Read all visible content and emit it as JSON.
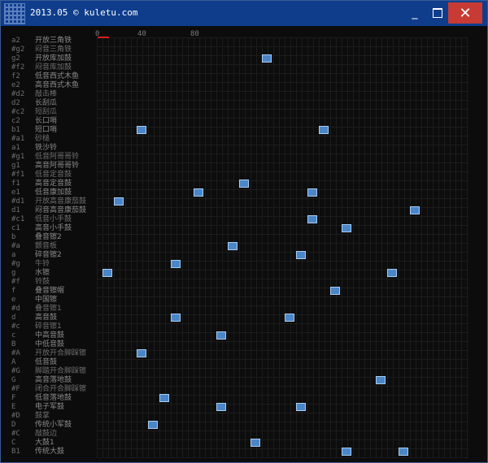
{
  "window": {
    "title": "2013.05 © kuletu.com",
    "icon": "grid-app-icon",
    "minimize": "_",
    "close": "✕"
  },
  "ruler": {
    "labels": [
      "0",
      "40",
      "80"
    ]
  },
  "rows": [
    {
      "note": "a2",
      "name": "开放三角铁"
    },
    {
      "note": "#g2",
      "name": "闷音三角铁"
    },
    {
      "note": "g2",
      "name": "开放库加鼓"
    },
    {
      "note": "#f2",
      "name": "闷音库加鼓"
    },
    {
      "note": "f2",
      "name": "低音西式木鱼"
    },
    {
      "note": "e2",
      "name": "高音西式木鱼"
    },
    {
      "note": "#d2",
      "name": "敲击棒"
    },
    {
      "note": "d2",
      "name": "长刮瓜"
    },
    {
      "note": "#c2",
      "name": "短刮瓜"
    },
    {
      "note": "c2",
      "name": "长口哨"
    },
    {
      "note": "b1",
      "name": "短口哨"
    },
    {
      "note": "#a1",
      "name": "砂槌"
    },
    {
      "note": "a1",
      "name": "铁沙铃"
    },
    {
      "note": "#g1",
      "name": "低音阿哥哥铃"
    },
    {
      "note": "g1",
      "name": "高音阿哥哥铃"
    },
    {
      "note": "#f1",
      "name": "低音定音鼓"
    },
    {
      "note": "f1",
      "name": "高音定音鼓"
    },
    {
      "note": "e1",
      "name": "低音康加鼓"
    },
    {
      "note": "#d1",
      "name": "开放高音康茄鼓"
    },
    {
      "note": "d1",
      "name": "闷音高音康茄鼓"
    },
    {
      "note": "#c1",
      "name": "低音小手鼓"
    },
    {
      "note": "c1",
      "name": "高音小手鼓"
    },
    {
      "note": "b",
      "name": "叠音镲2"
    },
    {
      "note": "#a",
      "name": "颤音板"
    },
    {
      "note": "a",
      "name": "碎音镲2"
    },
    {
      "note": "#g",
      "name": "牛铃"
    },
    {
      "note": "g",
      "name": "水镲"
    },
    {
      "note": "#f",
      "name": "铃鼓"
    },
    {
      "note": "f",
      "name": "叠音镲帽"
    },
    {
      "note": "e",
      "name": "中国镲"
    },
    {
      "note": "#d",
      "name": "叠音镲1"
    },
    {
      "note": "d",
      "name": "高音鼓"
    },
    {
      "note": "#c",
      "name": "碎音镲1"
    },
    {
      "note": "c",
      "name": "中高音鼓"
    },
    {
      "note": "B",
      "name": "中低音鼓"
    },
    {
      "note": "#A",
      "name": "开放开合脚踩镲"
    },
    {
      "note": "A",
      "name": "低音鼓"
    },
    {
      "note": "#G",
      "name": "脚踏开合脚踩镲"
    },
    {
      "note": "G",
      "name": "高音落地鼓"
    },
    {
      "note": "#F",
      "name": "闭合开合脚踩镲"
    },
    {
      "note": "F",
      "name": "低音落地鼓"
    },
    {
      "note": "E",
      "name": "电子军鼓"
    },
    {
      "note": "#D",
      "name": "鼓掌"
    },
    {
      "note": "D",
      "name": "传统小军鼓"
    },
    {
      "note": "#C",
      "name": "敲鼓边"
    },
    {
      "note": "C",
      "name": "大鼓1"
    },
    {
      "note": "B1",
      "name": "传统大鼓"
    }
  ],
  "beats": [
    {
      "row": 2,
      "step": 29
    },
    {
      "row": 10,
      "step": 7
    },
    {
      "row": 10,
      "step": 39
    },
    {
      "row": 16,
      "step": 25
    },
    {
      "row": 17,
      "step": 17
    },
    {
      "row": 17,
      "step": 37
    },
    {
      "row": 18,
      "step": 3
    },
    {
      "row": 19,
      "step": 55
    },
    {
      "row": 20,
      "step": 37
    },
    {
      "row": 21,
      "step": 43
    },
    {
      "row": 23,
      "step": 23
    },
    {
      "row": 24,
      "step": 35
    },
    {
      "row": 25,
      "step": 13
    },
    {
      "row": 26,
      "step": 1
    },
    {
      "row": 26,
      "step": 51
    },
    {
      "row": 28,
      "step": 41
    },
    {
      "row": 31,
      "step": 13
    },
    {
      "row": 31,
      "step": 33
    },
    {
      "row": 33,
      "step": 21
    },
    {
      "row": 35,
      "step": 7
    },
    {
      "row": 38,
      "step": 49
    },
    {
      "row": 40,
      "step": 11
    },
    {
      "row": 41,
      "step": 21
    },
    {
      "row": 41,
      "step": 35
    },
    {
      "row": 43,
      "step": 9
    },
    {
      "row": 45,
      "step": 27
    },
    {
      "row": 46,
      "step": 43
    },
    {
      "row": 46,
      "step": 53
    }
  ],
  "colors": {
    "titlebar": "#0f3d8c",
    "close_button": "#c83b35",
    "block_fill": "#4a86c8",
    "block_border": "#a8cdf0",
    "playhead": "#d11f1f"
  }
}
